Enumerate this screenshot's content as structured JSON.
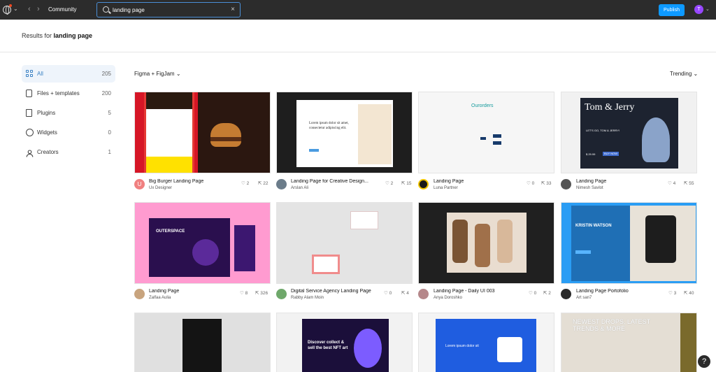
{
  "topbar": {
    "community": "Community",
    "search_value": "landing page",
    "publish": "Publish",
    "avatar_initial": "T"
  },
  "header": {
    "results_prefix": "Results for",
    "query": "landing page"
  },
  "sidebar": {
    "items": [
      {
        "label": "All",
        "count": "205"
      },
      {
        "label": "Files + templates",
        "count": "200"
      },
      {
        "label": "Plugins",
        "count": "5"
      },
      {
        "label": "Widgets",
        "count": "0"
      },
      {
        "label": "Creators",
        "count": "1"
      }
    ]
  },
  "filters": {
    "product": "Figma + FigJam",
    "sort": "Trending"
  },
  "cards": [
    {
      "title": "Big Burger Landing Page",
      "author": "Ux Designer",
      "likes": "2",
      "uses": "22",
      "avatar": "U"
    },
    {
      "title": "Landing Page for Creative Design...",
      "author": "Arslan Ali",
      "likes": "2",
      "uses": "15",
      "avatar": ""
    },
    {
      "title": "Landing Page",
      "author": "Luna Partner",
      "likes": "0",
      "uses": "33",
      "avatar": ""
    },
    {
      "title": "Landing Page",
      "author": "Nimesh Savlot",
      "likes": "4",
      "uses": "55",
      "avatar": ""
    },
    {
      "title": "Landing Page",
      "author": "Zalfaa Aulia",
      "likes": "8",
      "uses": "326",
      "avatar": ""
    },
    {
      "title": "Digital Service Agency Landing Page",
      "author": "Rabby Alam Moin",
      "likes": "0",
      "uses": "4",
      "avatar": ""
    },
    {
      "title": "Landing Page - Daily UI 003",
      "author": "Anya Doroshko",
      "likes": "0",
      "uses": "2",
      "avatar": ""
    },
    {
      "title": "Landing Page Portofolio",
      "author": "Art san7",
      "likes": "3",
      "uses": "40",
      "avatar": ""
    }
  ],
  "previews": {
    "lorem_long": "Lorem ipsum dolor sit amet, consectetur adipiscing elit.",
    "orders_logo": "Ourorders",
    "tom_title": "Tom & Jerry",
    "tom_sub": "LET'S GO, TOM & JERRY!",
    "tom_price": "$ 29.99",
    "tom_buy": "BUY NOW",
    "outerspace": "OUTERSPACE",
    "kristin": "KRISTIN WATSON",
    "nft": "Discover collect & sell the best NFT art",
    "lorem_short": "Lorem ipsum dolor sit",
    "newest": "NEWEST DROPS, LATEST TRENDS & MORE"
  },
  "colors": {
    "topbar": "#2c2c2c",
    "accent": "#0d99ff",
    "active_bg": "#eef4fb",
    "active_text": "#3b82c4"
  }
}
